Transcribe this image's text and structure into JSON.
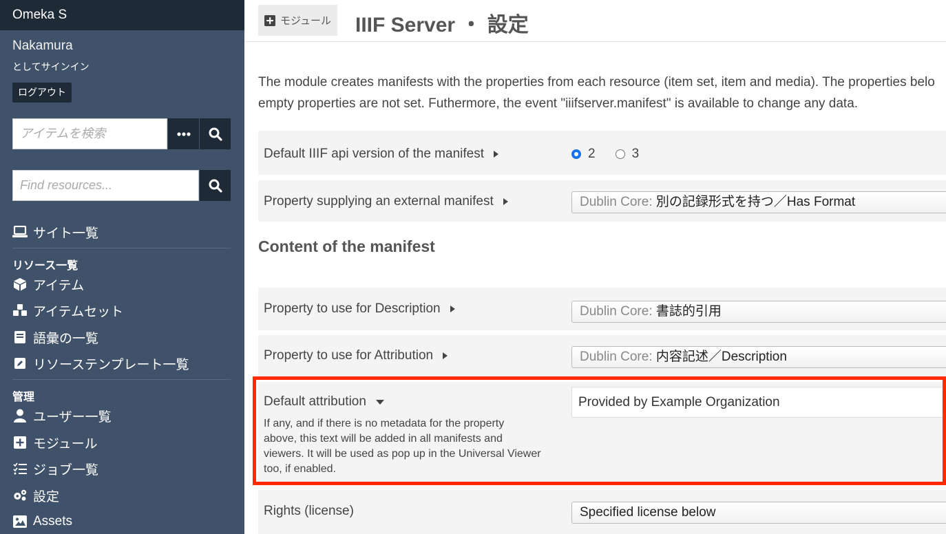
{
  "sidebar": {
    "brand": "Omeka S",
    "user_name": "Nakamura",
    "signed_in_as": "としてサインイン",
    "logout_label": "ログアウト",
    "item_search_placeholder": "アイテムを検索",
    "resource_search_placeholder": "Find resources...",
    "nav": {
      "sites": "サイト一覧",
      "resources_heading": "リソース一覧",
      "items": "アイテム",
      "item_sets": "アイテムセット",
      "vocabularies": "語彙の一覧",
      "resource_templates": "リソーステンプレート一覧",
      "admin_heading": "管理",
      "users": "ユーザー一覧",
      "modules": "モジュール",
      "jobs": "ジョブ一覧",
      "settings": "設定",
      "assets": "Assets"
    }
  },
  "header": {
    "crumb_label": "モジュール",
    "title": "IIIF Server ・ 設定"
  },
  "main": {
    "intro_line1": "The module creates manifests with the properties from each resource (item set, item and media). The properties belo",
    "intro_line2": "empty properties are not set. Futhermore, the event \"iiifserver.manifest\" is available to change any data.",
    "api_version": {
      "label": "Default IIIF api version of the manifest",
      "options": [
        "2",
        "3"
      ],
      "selected": "2"
    },
    "external_manifest": {
      "label": "Property supplying an external manifest",
      "vocab": "Dublin Core:",
      "value": "別の記録形式を持つ／Has Format"
    },
    "section_title": "Content of the manifest",
    "description_prop": {
      "label": "Property to use for Description",
      "vocab": "Dublin Core:",
      "value": "書誌的引用"
    },
    "attribution_prop": {
      "label": "Property to use for Attribution",
      "vocab": "Dublin Core:",
      "value": "内容記述／Description"
    },
    "default_attribution": {
      "label": "Default attribution",
      "help_line1": "If any, and if there is no metadata for the property",
      "help_line2": "above, this text will be added in all manifests and",
      "help_line3": "viewers. It will be used as pop up in the Universal Viewer",
      "help_line4": "too, if enabled.",
      "value": "Provided by Example Organization"
    },
    "rights": {
      "label": "Rights (license)",
      "value": "Specified license below"
    }
  },
  "colors": {
    "sidebar_bg": "#3f5269",
    "sidebar_dark": "#1f2a37",
    "highlight": "#ff2a00",
    "radio_accent": "#1a73e8"
  }
}
